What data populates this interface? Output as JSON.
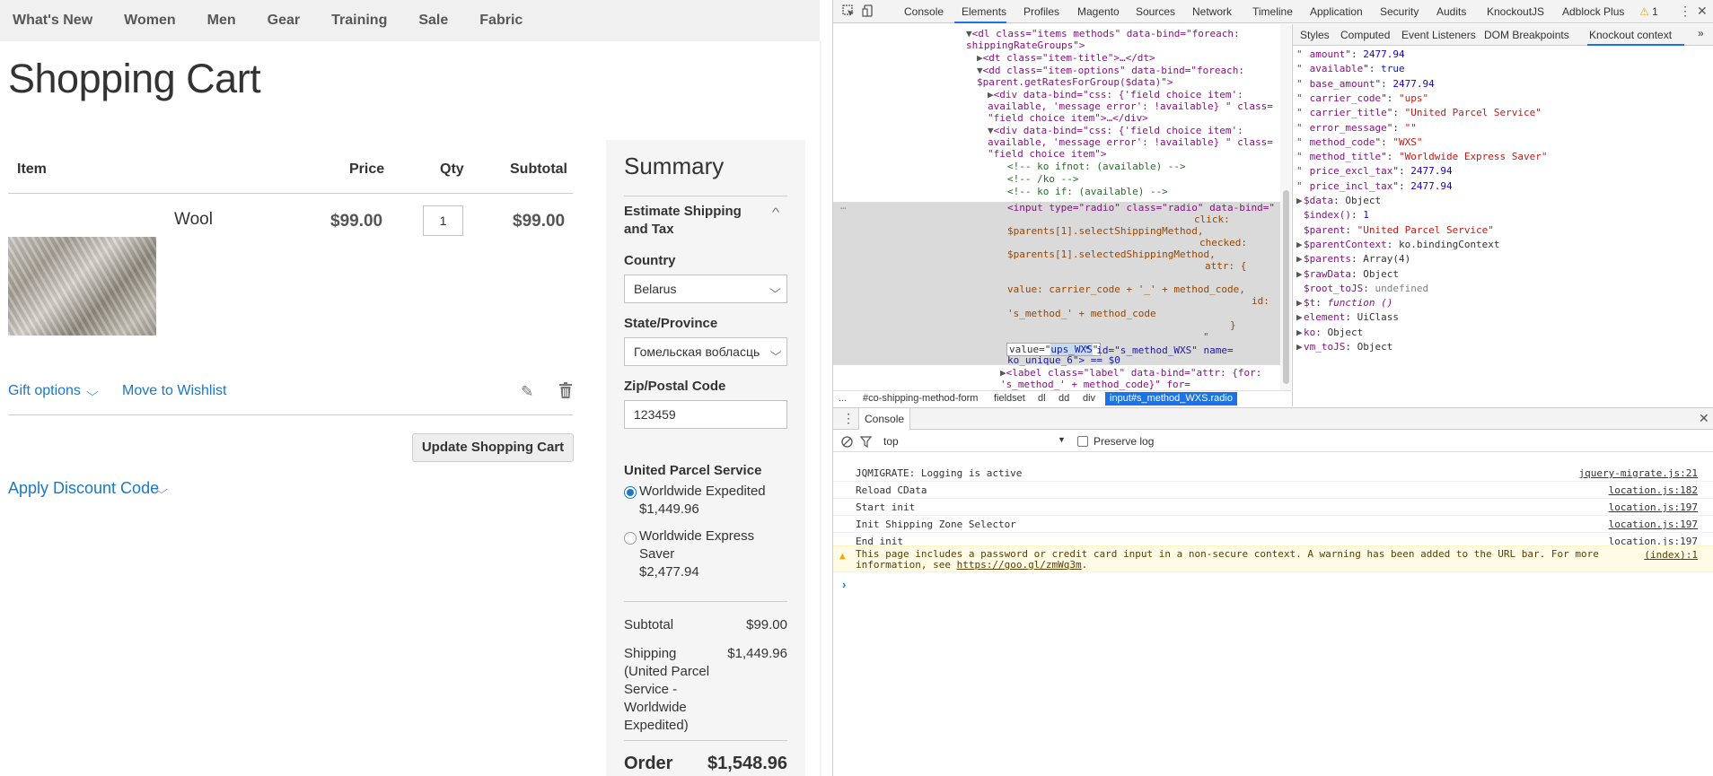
{
  "nav": [
    "What's New",
    "Women",
    "Men",
    "Gear",
    "Training",
    "Sale",
    "Fabric"
  ],
  "page_title": "Shopping Cart",
  "table": {
    "headers": {
      "item": "Item",
      "price": "Price",
      "qty": "Qty",
      "subtotal": "Subtotal"
    },
    "row": {
      "name": "Wool",
      "price": "$99.00",
      "qty": "1",
      "subtotal": "$99.00"
    }
  },
  "cart_actions": {
    "gift_options": "Gift options",
    "move_wishlist": "Move to Wishlist",
    "update": "Update Shopping Cart",
    "discount": "Apply Discount Code"
  },
  "summary": {
    "title": "Summary",
    "estimate": "Estimate Shipping and Tax",
    "country_label": "Country",
    "country_value": "Belarus",
    "state_label": "State/Province",
    "state_value": "Гомельская вобласць",
    "zip_label": "Zip/Postal Code",
    "zip_value": "123459",
    "carrier": "United Parcel Service",
    "method1_name": "Worldwide Expedited",
    "method1_price": "$1,449.96",
    "method2_name": "Worldwide Express Saver",
    "method2_price": "$2,477.94",
    "subtotal_label": "Subtotal",
    "subtotal_value": "$99.00",
    "shipping_label": "Shipping (United Parcel Service - Worldwide Expedited)",
    "shipping_value": "$1,449.96",
    "order_label": "Order",
    "order_value": "$1,548.96"
  },
  "devtools": {
    "tabs": [
      "Console",
      "Elements",
      "Profiles",
      "Magento",
      "Sources",
      "Network",
      "Timeline",
      "Application",
      "Security",
      "Audits",
      "KnockoutJS",
      "Adblock Plus"
    ],
    "active_tab": "Elements",
    "warning_count": "1",
    "code_lines": [
      "<dl class=\"items methods\" data-bind=\"foreach:",
      "shippingRateGroups\">",
      "<dt class=\"item-title\">…</dt>",
      "<dd class=\"item-options\" data-bind=\"foreach:",
      "$parent.getRatesForGroup($data)\">",
      "<div data-bind=\"css: {'field choice item':",
      "available, 'message error': !available} \" class=",
      "\"field choice item\">…</div>",
      "<div data-bind=\"css: {'field choice item':",
      "available, 'message error': !available} \" class=",
      "\"field choice item\">",
      "<!-- ko ifnot: (available) -->",
      "<!-- /ko -->",
      "<!-- ko if: (available) -->",
      "<input type=\"radio\" class=\"radio\" data-bind=\"",
      "click:",
      "$parents[1].selectShippingMethod,",
      "checked:",
      "$parents[1].selectedShippingMethod,",
      "attr: {",
      "value: carrier_code + '_' + method_code,",
      "id:",
      "'s_method_' + method_code",
      "}",
      "\"",
      "value=\"",
      "ups_WXS",
      "\" id=\"s_method_WXS\" name=",
      "ko_unique_6\"> == $0",
      "<label class=\"label\" data-bind=\"attr: {for:",
      "'s_method_' + method_code}\" for="
    ],
    "breadcrumbs": [
      "...",
      "#co-shipping-method-form",
      "fieldset",
      "dl",
      "dd",
      "div",
      "input#s_method_WXS.radio"
    ],
    "sidebar_tabs": [
      "Styles",
      "Computed",
      "Event Listeners",
      "DOM Breakpoints",
      "Knockout context"
    ],
    "sidebar_active": "Knockout context",
    "props": [
      {
        "k": "amount",
        "v": "2477.94",
        "t": "n"
      },
      {
        "k": "available",
        "v": "true",
        "t": "b"
      },
      {
        "k": "base_amount",
        "v": "2477.94",
        "t": "n"
      },
      {
        "k": "carrier_code",
        "v": "\"ups\"",
        "t": "s"
      },
      {
        "k": "carrier_title",
        "v": "\"United Parcel Service\"",
        "t": "s"
      },
      {
        "k": "error_message",
        "v": "\"\"",
        "t": "s"
      },
      {
        "k": "method_code",
        "v": "\"WXS\"",
        "t": "s"
      },
      {
        "k": "method_title",
        "v": "\"Worldwide Express Saver\"",
        "t": "s"
      },
      {
        "k": "price_excl_tax",
        "v": "2477.94",
        "t": "n"
      },
      {
        "k": "price_incl_tax",
        "v": "2477.94",
        "t": "n"
      }
    ],
    "ctx": [
      {
        "k": "$data",
        "v": "Object",
        "exp": true
      },
      {
        "k": "$index()",
        "v": "1",
        "t": "n"
      },
      {
        "k": "$parent",
        "v": "\"United Parcel Service\"",
        "t": "s"
      },
      {
        "k": "$parentContext",
        "v": "ko.bindingContext",
        "exp": true
      },
      {
        "k": "$parents",
        "v": "Array(4)",
        "exp": true
      },
      {
        "k": "$rawData",
        "v": "Object",
        "exp": true
      },
      {
        "k": "$root_toJS",
        "v": "undefined",
        "t": "u"
      },
      {
        "k": "$t",
        "v": "function ()",
        "exp": true,
        "t": "f"
      },
      {
        "k": "element",
        "v": "UiClass",
        "exp": true
      },
      {
        "k": "ko",
        "v": "Object",
        "exp": true
      },
      {
        "k": "vm_toJS",
        "v": "Object",
        "exp": true
      }
    ],
    "console": {
      "title": "Console",
      "context": "top",
      "preserve_log": "Preserve log",
      "messages": [
        {
          "m": "JQMIGRATE: Logging is active",
          "src": "jquery-migrate.js:21"
        },
        {
          "m": "Reload CData",
          "src": "location.js:182"
        },
        {
          "m": "Start init",
          "src": "location.js:197"
        },
        {
          "m": "Init Shipping Zone Selector",
          "src": "location.js:197"
        },
        {
          "m": "End init",
          "src": "location.js:197"
        }
      ],
      "warning": {
        "m": "This page includes a password or credit card input in a non-secure context. A warning has been added to the URL bar. For more",
        "m2": "information, see ",
        "link": "https://goo.gl/zmWq3m",
        "m3": ".",
        "src": "(index):1"
      }
    }
  }
}
